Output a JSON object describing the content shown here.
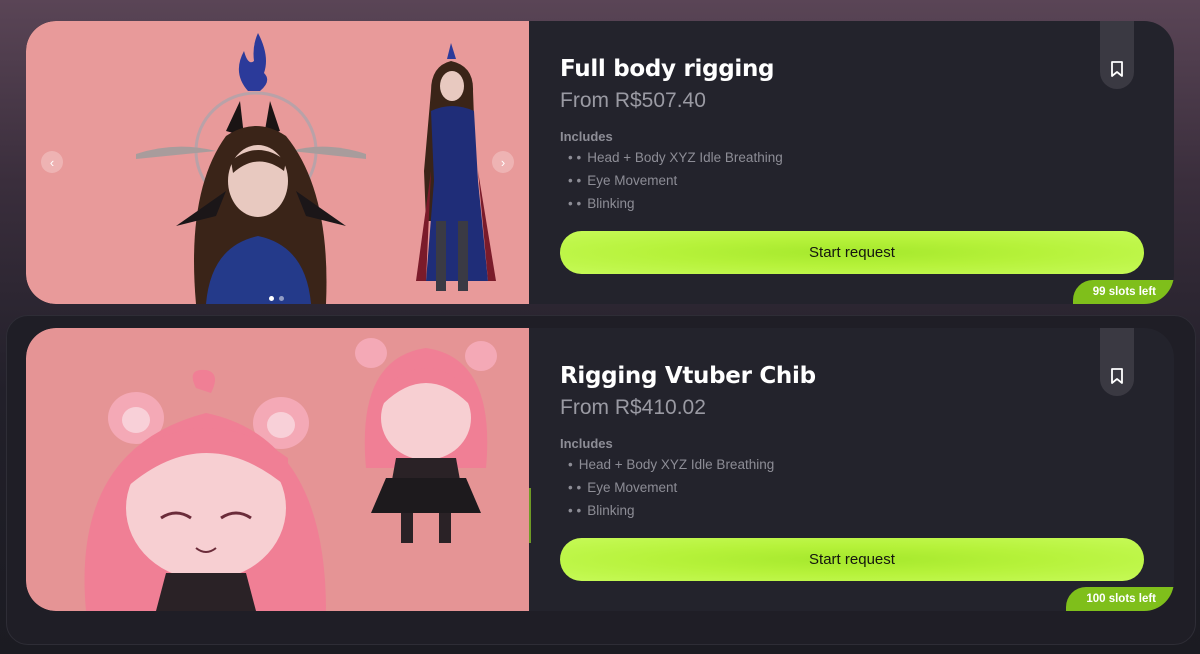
{
  "cards": [
    {
      "title": "Full body rigging",
      "price": "From R$507.40",
      "includes_label": "Includes",
      "includes": [
        {
          "bullet": "• •",
          "text": "Head + Body XYZ Idle Breathing"
        },
        {
          "bullet": "• •",
          "text": "Eye Movement"
        },
        {
          "bullet": "• •",
          "text": "Blinking"
        }
      ],
      "cta": "Start request",
      "slots": "99 slots left",
      "carousel": {
        "prev": "‹",
        "next": "›",
        "slide_count": 2,
        "active_slide": 1
      }
    },
    {
      "title": "Rigging Vtuber Chib",
      "price": "From R$410.02",
      "includes_label": "Includes",
      "includes": [
        {
          "bullet": "•",
          "text": "Head + Body XYZ Idle Breathing"
        },
        {
          "bullet": "• •",
          "text": "Eye Movement"
        },
        {
          "bullet": "• •",
          "text": "Blinking"
        }
      ],
      "cta": "Start request",
      "slots": "100 slots left"
    }
  ],
  "icons": {
    "bookmark": "bookmark-icon"
  },
  "colors": {
    "accent": "#b6f23a",
    "slots_badge": "#7fbf1b",
    "card_bg": "#23232c"
  }
}
